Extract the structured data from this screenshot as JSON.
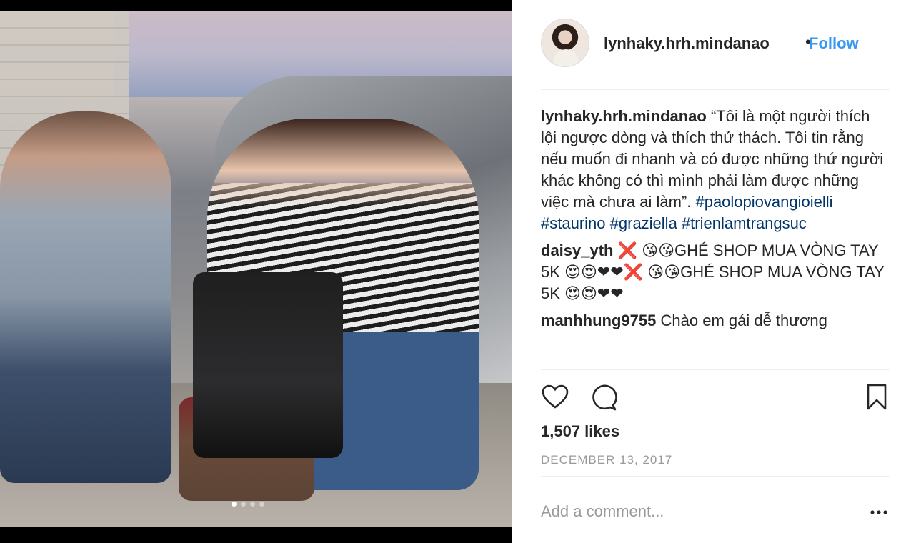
{
  "post": {
    "username": "lynhaky.hrh.mindanao",
    "separator": "•",
    "follow_label": "Follow",
    "carousel_count": 4,
    "carousel_active": 1
  },
  "caption": {
    "user": "lynhaky.hrh.mindanao",
    "text": "“Tôi là một người thích lội ngược dòng và thích thử thách. Tôi tin rằng nếu muốn đi nhanh và có được những thứ người khác không có thì mình phải làm được những việc mà chưa ai làm”.",
    "hashtags": [
      "#paolopiovangioielli",
      "#staurino",
      "#graziella",
      "#trienlamtrangsuc"
    ]
  },
  "comments": [
    {
      "user": "daisy_yth",
      "text": "❌ 😘😘GHÉ SHOP MUA VÒNG TAY 5K 😍😍❤❤❌ 😘😘GHÉ SHOP MUA VÒNG TAY 5K 😍😍❤❤"
    },
    {
      "user": "manhhung9755",
      "text": "Chào em gái dễ thương"
    }
  ],
  "actions": {
    "like_icon": "heart-icon",
    "comment_icon": "comment-bubble-icon",
    "save_icon": "bookmark-icon"
  },
  "likes_text": "1,507 likes",
  "date_text": "DECEMBER 13, 2017",
  "add_comment_placeholder": "Add a comment...",
  "more_icon": "more-options-icon",
  "colors": {
    "link": "#3897f0",
    "hashtag": "#003569",
    "text": "#262626",
    "muted": "#999999"
  }
}
